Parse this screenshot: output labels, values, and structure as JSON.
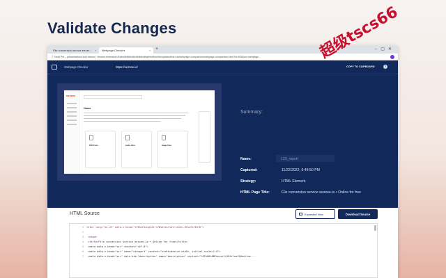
{
  "headline": "Validate Changes",
  "browser": {
    "tabs": [
      {
        "label": "File conversion service eezze..."
      },
      {
        "label": "Webpage Checker"
      }
    ],
    "new_tab": "+",
    "window_controls": "–▢✕",
    "address": "7 Tmail  Pnt – presentations and videos | chrome-extension://bdmdidhlbkhkbhbfimbnikgfehd/html/templates/test-run/webpage-comparison/webpage-comparison.html?id=636&sv=webpage..."
  },
  "app": {
    "name": "Webpage Checker",
    "url": "https://eezzee.io/",
    "copy_label": "COPY TO CLIPBOARD",
    "help": "?",
    "summary": {
      "title": "Summary:",
      "rows": [
        {
          "label": "Name:",
          "value": "123_report"
        },
        {
          "label": "Captured:",
          "value": "11/22/2022, 6:48:50 PM"
        },
        {
          "label": "Strategy:",
          "value": "HTML Element"
        },
        {
          "label": "HTML Page Title:",
          "value": "File conversion service eezzee.io • Online for free"
        }
      ]
    },
    "preview": {
      "logo": "eezzee",
      "page_title": "Home",
      "cards": [
        "PDF Tools",
        "Audio Files",
        "Image Files"
      ]
    }
  },
  "html_source": {
    "title": "HTML Source",
    "expanded_label": "Expanded View",
    "download_label": "Download Source",
    "lines": [
      {
        "n": "1",
        "code": "<html lang=\"en-US\" data-n-head=\"%7B%22lang%22:%7B%22ssr%22:%22en-US%22%7D%7D\">"
      },
      {
        "n": "2",
        "code": ""
      },
      {
        "n": "3",
        "code": "  <head>"
      },
      {
        "n": "4",
        "code": "    <title>File conversion service eezzee.io • Online for free</title>"
      },
      {
        "n": "5",
        "code": "    <meta data-n-head=\"ssr\" charset=\"utf-8\">"
      },
      {
        "n": "6",
        "code": "    <meta data-n-head=\"ssr\" name=\"viewport\" content=\"width=device-width, initial-scale=1.0\">"
      },
      {
        "n": "7",
        "code": "    <meta data-n-head=\"ssr\" data-hid=\"description\" name=\"description\" content=\"%E2%80%8BConvert%20files%20online..."
      }
    ]
  },
  "watermark": "超级tscs66"
}
